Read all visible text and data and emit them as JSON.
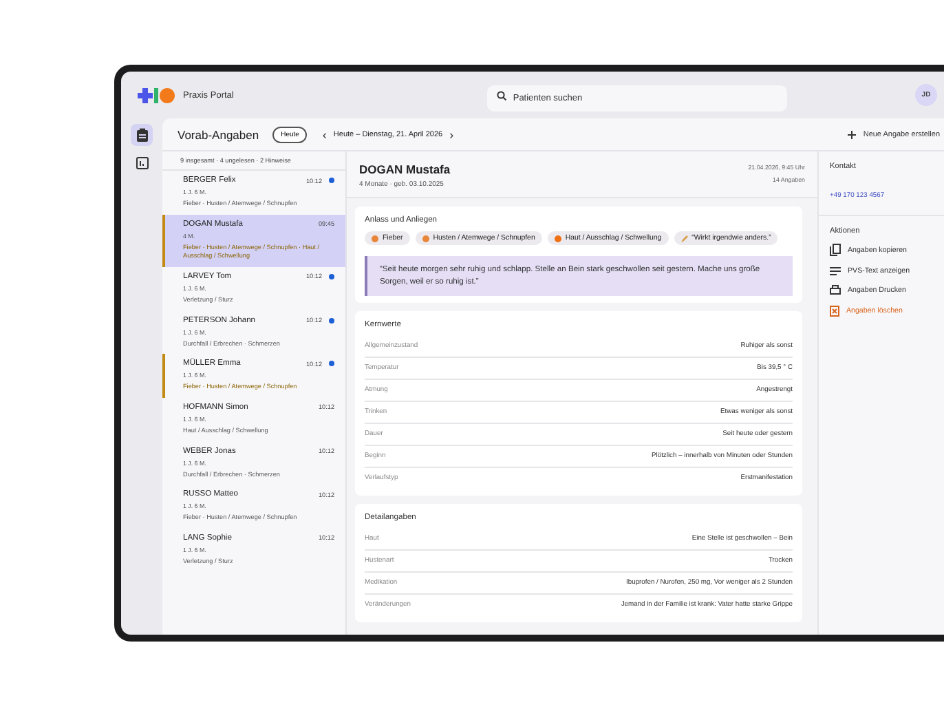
{
  "app": {
    "title": "Praxis Portal",
    "search_placeholder": "Patienten suchen",
    "avatar": "JD"
  },
  "rail": [
    {
      "kind": "clipboard",
      "selected": true
    },
    {
      "kind": "chart",
      "selected": false
    }
  ],
  "header": {
    "title": "Vorab-Angaben",
    "today_button": "Heute",
    "prev": "‹",
    "next": "›",
    "date": "Heute – Dienstag, 21. April 2026",
    "new_button": "Neue Angabe erstellen"
  },
  "summary": "9 insgesamt · 4 ungelesen · 2 Hinweise",
  "patients": [
    {
      "name": "BERGER Felix",
      "time": "10:12",
      "age": "1 J. 6 M.",
      "reasons": "Fieber · Husten / Atemwege / Schnupfen",
      "unread": true,
      "flagged": false,
      "selected": false
    },
    {
      "name": "DOGAN Mustafa",
      "time": "09:45",
      "age": "4 M.",
      "reasons": "Fieber · Husten / Atemwege / Schnupfen · Haut / Ausschlag / Schwellung",
      "unread": false,
      "flagged": true,
      "selected": true
    },
    {
      "name": "LARVEY Tom",
      "time": "10:12",
      "age": "1 J. 6 M.",
      "reasons": "Verletzung / Sturz",
      "unread": true,
      "flagged": false,
      "selected": false
    },
    {
      "name": "PETERSON Johann",
      "time": "10:12",
      "age": "1 J. 6 M.",
      "reasons": "Durchfall / Erbrechen · Schmerzen",
      "unread": true,
      "flagged": false,
      "selected": false
    },
    {
      "name": "MÜLLER Emma",
      "time": "10:12",
      "age": "1 J. 6 M.",
      "reasons": "Fieber · Husten / Atemwege / Schnupfen",
      "unread": true,
      "flagged": true,
      "selected": false
    },
    {
      "name": "HOFMANN Simon",
      "time": "10:12",
      "age": "1 J. 6 M.",
      "reasons": "Haut / Ausschlag / Schwellung",
      "unread": false,
      "flagged": false,
      "selected": false
    },
    {
      "name": "WEBER Jonas",
      "time": "10:12",
      "age": "1 J. 6 M.",
      "reasons": "Durchfall / Erbrechen · Schmerzen",
      "unread": false,
      "flagged": false,
      "selected": false
    },
    {
      "name": "RUSSO Matteo",
      "time": "10:12",
      "age": "1 J. 6 M.",
      "reasons": "Fieber · Husten / Atemwege / Schnupfen",
      "unread": false,
      "flagged": false,
      "selected": false
    },
    {
      "name": "LANG Sophie",
      "time": "10:12",
      "age": "1 J. 6 M.",
      "reasons": "Verletzung / Sturz",
      "unread": false,
      "flagged": false,
      "selected": false
    }
  ],
  "detail": {
    "name": "DOGAN Mustafa",
    "subtitle": "4 Monate · geb. 03.10.2025",
    "timestamp": "21.04.2026, 9:45 Uhr",
    "count": "14 Angaben",
    "concern": {
      "title": "Anlass und Anliegen",
      "chips": [
        {
          "kind": "fever",
          "label": "Fieber"
        },
        {
          "kind": "cough",
          "label": "Husten / Atemwege / Schnupfen"
        },
        {
          "kind": "skin",
          "label": "Haut / Ausschlag / Schwellung"
        },
        {
          "kind": "note",
          "label": "“Wirkt irgendwie anders.”"
        }
      ],
      "quote": "“Seit heute morgen sehr ruhig und schlapp. Stelle an Bein stark geschwollen seit gestern. Mache uns große Sorgen, weil er so ruhig ist.”"
    },
    "sections": [
      {
        "title": "Kernwerte",
        "rows": [
          {
            "label": "Allgemeinzustand",
            "value": "Ruhiger als sonst"
          },
          {
            "label": "Temperatur",
            "value": "Bis 39,5 ° C"
          },
          {
            "label": "Atmung",
            "value": "Angestrengt"
          },
          {
            "label": "Trinken",
            "value": "Etwas weniger als sonst"
          },
          {
            "label": "Dauer",
            "value": "Seit heute oder gestern"
          },
          {
            "label": "Beginn",
            "value": "Plötzlich – innerhalb von Minuten oder Stunden"
          },
          {
            "label": "Verlaufstyp",
            "value": "Erstmanifestation"
          }
        ]
      },
      {
        "title": "Detailangaben",
        "rows": [
          {
            "label": "Haut",
            "value": "Eine Stelle ist geschwollen – Bein"
          },
          {
            "label": "Hustenart",
            "value": "Trocken"
          },
          {
            "label": "Medikation",
            "value": "Ibuprofen / Nurofen, 250 mg, Vor weniger als 2 Stunden"
          },
          {
            "label": "Veränderungen",
            "value": "Jemand in der Familie ist krank: Vater hatte starke Grippe"
          }
        ]
      }
    ]
  },
  "side": {
    "contact_title": "Kontakt",
    "phone": "+49 170 123 4567",
    "actions_title": "Aktionen",
    "actions": [
      {
        "kind": "copy",
        "label": "Angaben kopieren",
        "danger": false
      },
      {
        "kind": "text",
        "label": "PVS-Text anzeigen",
        "danger": false
      },
      {
        "kind": "print",
        "label": "Angaben Drucken",
        "danger": false
      },
      {
        "kind": "delete",
        "label": "Angaben löschen",
        "danger": true
      }
    ]
  }
}
